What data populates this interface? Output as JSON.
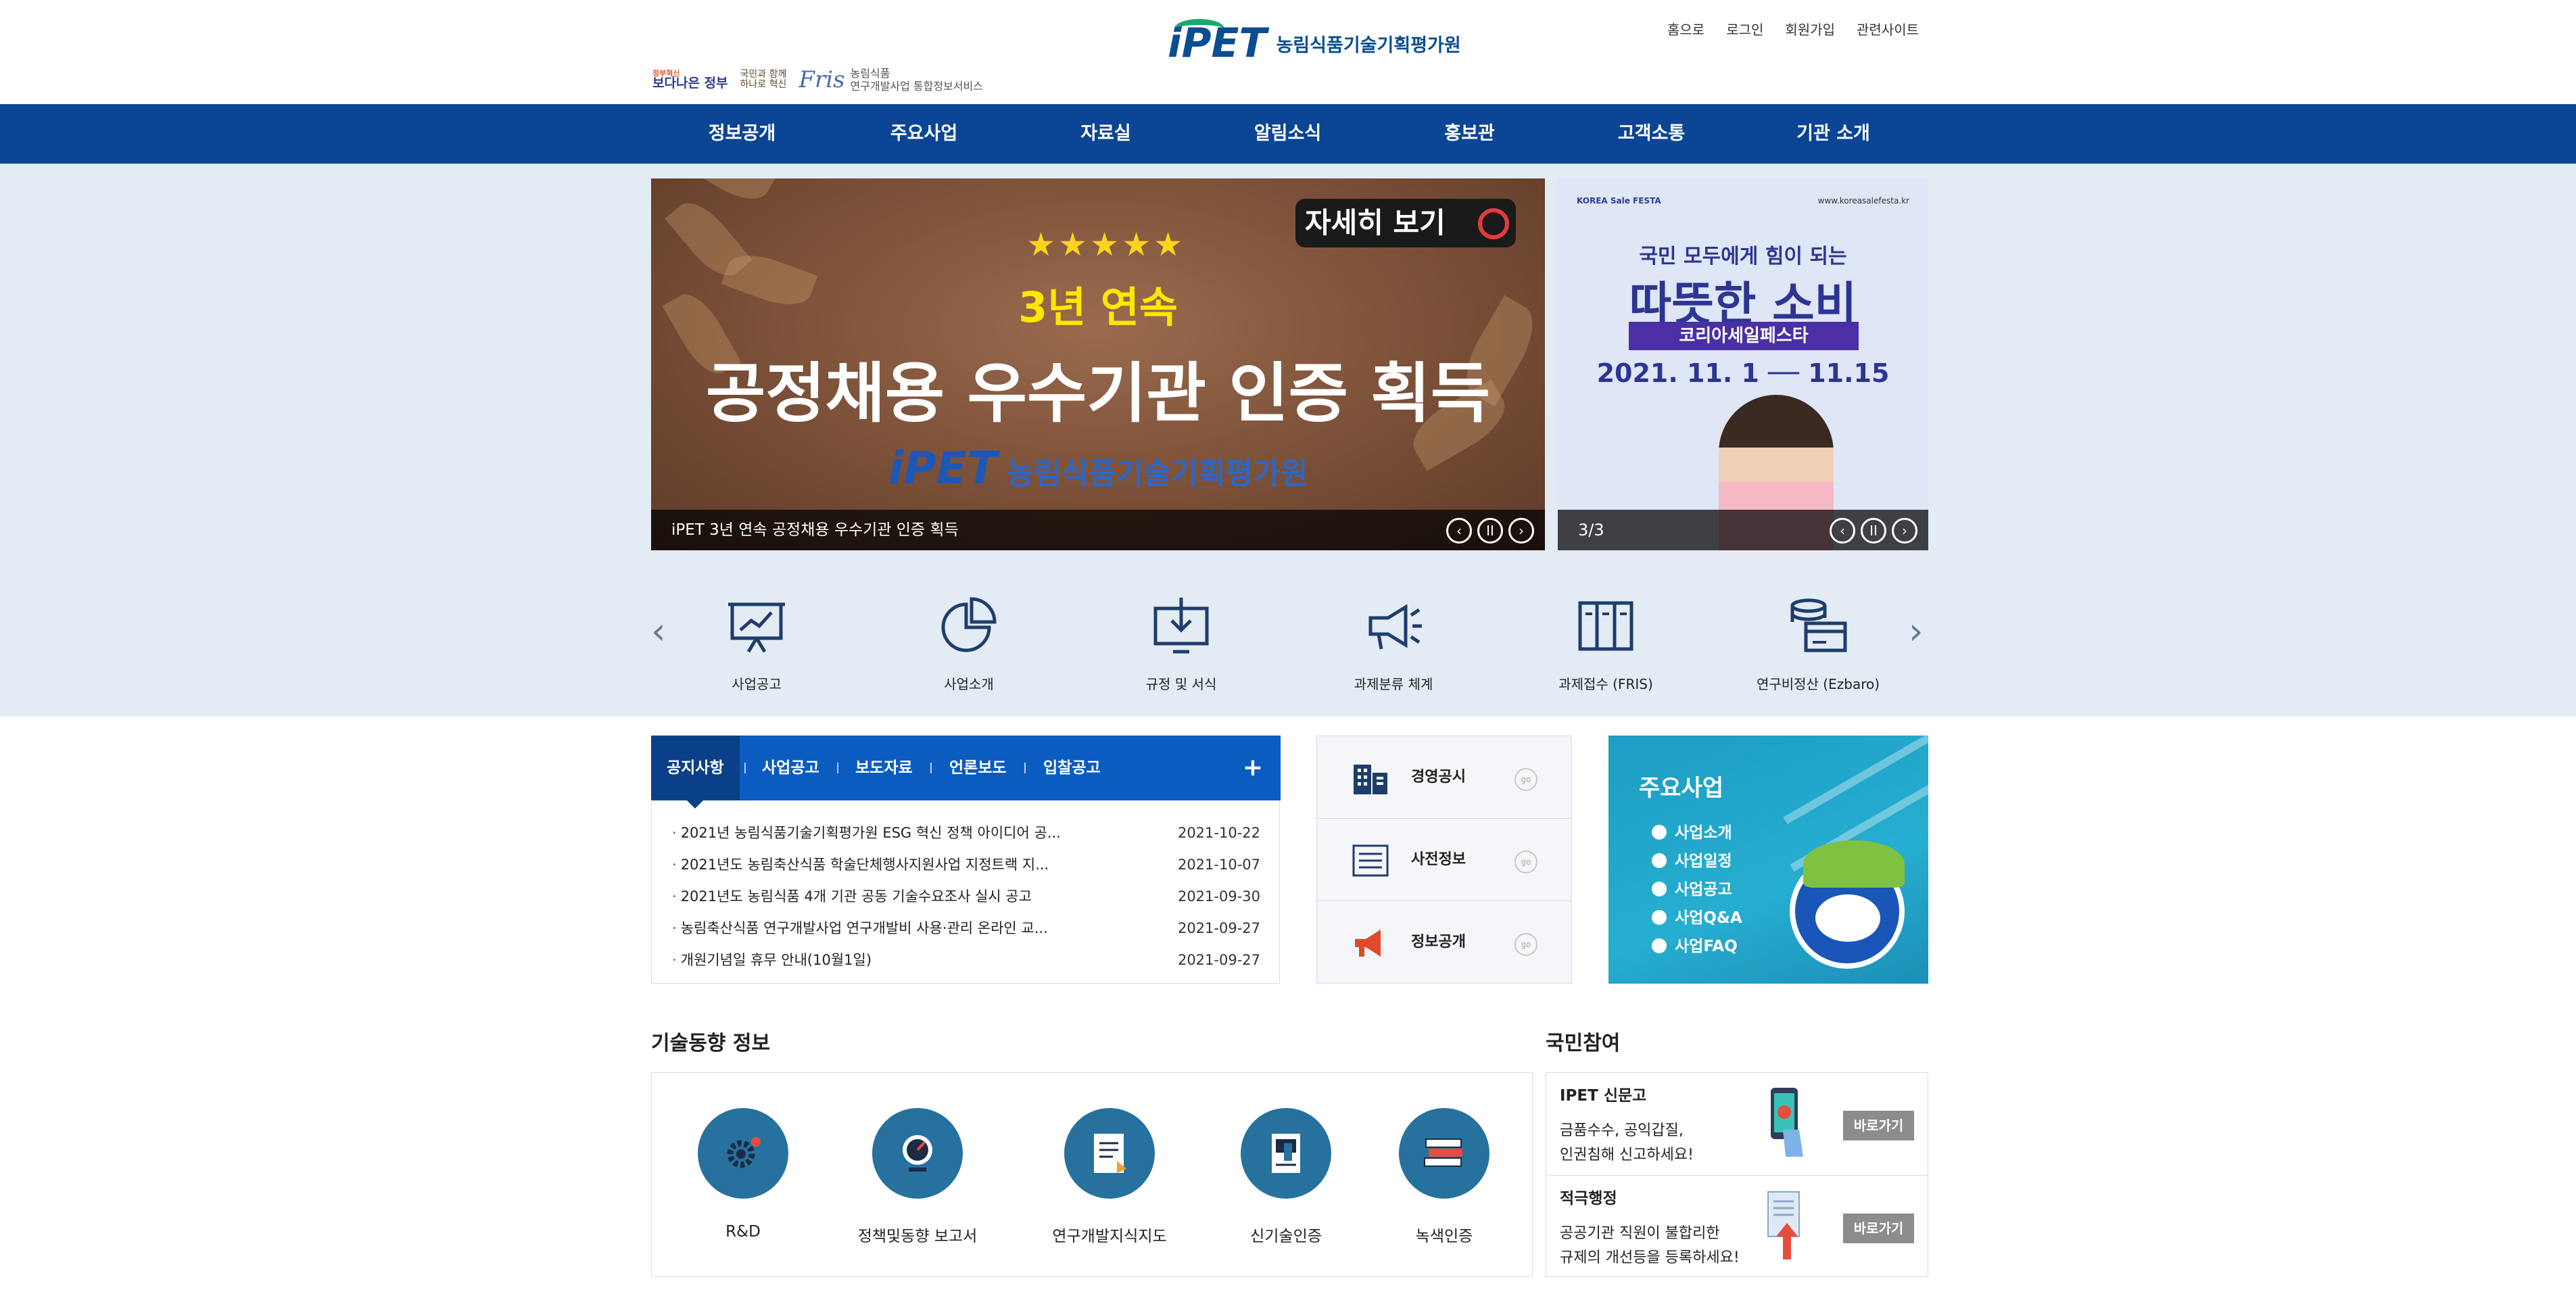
{
  "header": {
    "logo_mark": "iPET",
    "logo_name": "농림식품기술기획평가원",
    "top_links": [
      "홈으로",
      "로그인",
      "회원가입",
      "관련사이트"
    ],
    "gov_logos": {
      "g1_small": "정부혁신",
      "g1": "보다나은 정부",
      "g2_line1": "국민과 함께",
      "g2_line2": "하나로 혁신",
      "fris": "Fris",
      "fris_text1": "농림식품",
      "fris_text2": "연구개발사업 통합정보서비스"
    }
  },
  "nav": {
    "items": [
      "정보공개",
      "주요사업",
      "자료실",
      "알림소식",
      "홍보관",
      "고객소통",
      "기관 소개"
    ]
  },
  "main_banner": {
    "stars": "★★★★★",
    "subtitle": "3년 연속",
    "title": "공정채용 우수기관 인증 획득",
    "brand_mark": "iPET",
    "brand_name": "농림식품기술기획평가원",
    "detail_button": "자세히 보기",
    "caption": "iPET 3년 연속 공정채용 우수기관 인증 획득",
    "controls": [
      "‹",
      "II",
      "›"
    ]
  },
  "side_banner": {
    "tag": "KOREA Sale FESTA",
    "url": "www.koreasalefesta.kr",
    "line1": "국민 모두에게 힘이 되는",
    "line2": "따뜻한 소비",
    "line3": "코리아세일페스타",
    "line4": "2021. 11. 1 ── 11.15",
    "counter": "3/3",
    "controls": [
      "‹",
      "II",
      "›"
    ]
  },
  "quick_icons": {
    "prev": "‹",
    "next": "›",
    "items": [
      {
        "label": "사업공고",
        "icon": "presentation-chart-icon"
      },
      {
        "label": "사업소개",
        "icon": "pie-chart-icon"
      },
      {
        "label": "규정 및 서식",
        "icon": "download-box-icon"
      },
      {
        "label": "과제분류 체계",
        "icon": "megaphone-icon"
      },
      {
        "label": "과제접수 (FRIS)",
        "icon": "binders-icon"
      },
      {
        "label": "연구비정산 (Ezbaro)",
        "icon": "coins-card-icon"
      }
    ]
  },
  "board": {
    "tabs": [
      "공지사항",
      "사업공고",
      "보도자료",
      "언론보도",
      "입찰공고"
    ],
    "more": "+",
    "notices": [
      {
        "title": "2021년 농림식품기술기획평가원 ESG 혁신 정책 아이디어 공...",
        "date": "2021-10-22"
      },
      {
        "title": "2021년도 농림축산식품 학술단체행사지원사업 지정트랙 지...",
        "date": "2021-10-07"
      },
      {
        "title": "2021년도 농림식품 4개 기관 공동 기술수요조사 실시 공고",
        "date": "2021-09-30"
      },
      {
        "title": "농림축산식품 연구개발사업 연구개발비 사용·관리 온라인 교...",
        "date": "2021-09-27"
      },
      {
        "title": "개원기념일 휴무 안내(10월1일)",
        "date": "2021-09-27"
      }
    ]
  },
  "quick_links": {
    "go": "go",
    "items": [
      "경영공시",
      "사전정보",
      "정보공개"
    ]
  },
  "business": {
    "title": "주요사업",
    "items": [
      "사업소개",
      "사업일정",
      "사업공고",
      "사업Q&A",
      "사업FAQ"
    ]
  },
  "tech": {
    "title": "기술동향 정보",
    "items": [
      "R&D",
      "정책및동향 보고서",
      "연구개발지식지도",
      "신기술인증",
      "녹색인증"
    ]
  },
  "citizen": {
    "title": "국민참여",
    "boxes": [
      {
        "title": "IPET 신문고",
        "desc1": "금품수수, 공익갑질,",
        "desc2": "인권침해 신고하세요!",
        "button": "바로가기"
      },
      {
        "title": "적극행정",
        "desc1": "공공기관 직원이 불합리한",
        "desc2": "규제의 개선등을 등록하세요!",
        "button": "바로가기"
      }
    ]
  },
  "colors": {
    "nav": "#0b4594",
    "board_tabs": "#0b5cc0",
    "band": "#e3ebf4",
    "business": "#1d9dc3"
  }
}
